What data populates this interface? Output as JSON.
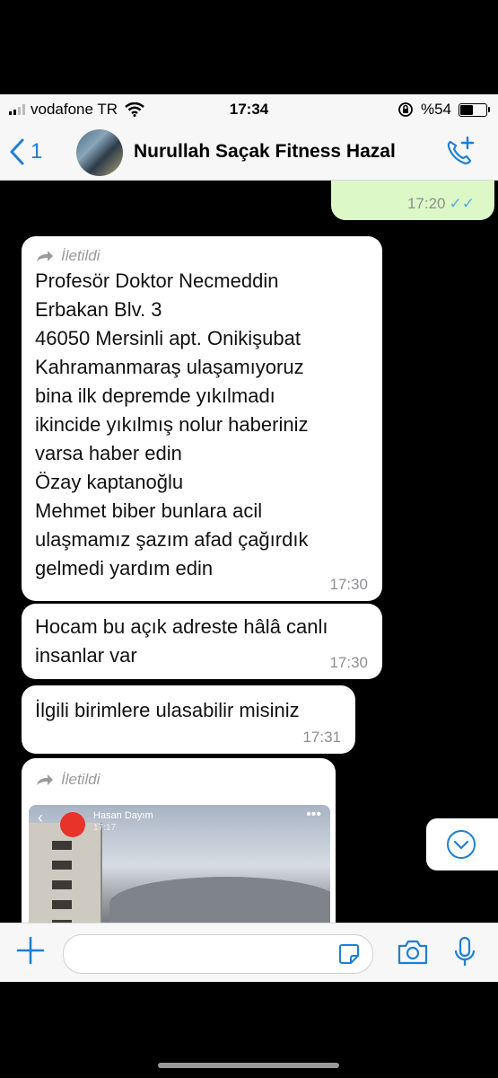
{
  "status_bar": {
    "carrier": "vodafone TR",
    "time": "17:34",
    "battery": "%54",
    "battery_level": 0.54
  },
  "nav": {
    "back_count": "1",
    "title": "Nurullah Saçak Fitness Hazal"
  },
  "messages": {
    "outgoing_time": "17:20",
    "m1": {
      "forwarded": "İletildi",
      "text": "Profesör Doktor Necmeddin\nErbakan Blv. 3\n46050 Mersinli apt. Onikişubat\nKahramanmaraş ulaşamıyoruz\nbina ilk depremde yıkılmadı\nikincide yıkılmış nolur haberiniz\nvarsa haber edin\nÖzay kaptanoğlu\nMehmet biber bunlara acil\nulaşmamız şazım afad çağırdık\ngelmedi yardım edin",
      "time": "17:30"
    },
    "m2": {
      "text": "Hocam bu açık adreste hâlâ canlı\ninsanlar var",
      "time": "17:30"
    },
    "m3": {
      "text": "İlgili birimlere ulasabilir misiniz",
      "time": "17:31"
    },
    "m4": {
      "forwarded": "İletildi",
      "video_sender": "Hasan Dayım",
      "video_time": "17:17"
    }
  },
  "icons": [
    "chevron-left-icon",
    "call-add-icon",
    "forward-icon",
    "scroll-down-icon",
    "plus-icon",
    "sticker-icon",
    "camera-icon",
    "mic-icon"
  ],
  "colors": {
    "accent": "#1f7fd4",
    "outgoing_bubble": "#dcf8c6",
    "read_ticks": "#5aa9e6"
  }
}
